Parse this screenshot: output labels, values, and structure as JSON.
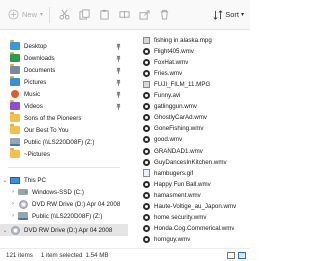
{
  "toolbar": {
    "new_label": "New",
    "sort_label": "Sort",
    "icons": [
      "cut-icon",
      "copy-icon",
      "paste-icon",
      "rename-icon",
      "share-icon",
      "delete-icon"
    ]
  },
  "nav": {
    "items": [
      {
        "label": "Desktop",
        "icon": "folder",
        "pinned": true
      },
      {
        "label": "Downloads",
        "icon": "folder",
        "pinned": true
      },
      {
        "label": "Documents",
        "icon": "folder",
        "pinned": true
      },
      {
        "label": "Pictures",
        "icon": "folder",
        "pinned": true
      },
      {
        "label": "Music",
        "icon": "folder",
        "pinned": true
      },
      {
        "label": "Videos",
        "icon": "folder",
        "pinned": true
      },
      {
        "label": "Sons of the Pioneers",
        "icon": "folder",
        "pinned": false
      },
      {
        "label": "Our Best To You",
        "icon": "folder",
        "pinned": false
      },
      {
        "label": "Public (\\\\LS220D08F) (Z:)",
        "icon": "netdrive",
        "pinned": false
      },
      {
        "label": "~Pictures",
        "icon": "folder",
        "pinned": false
      },
      {
        "label": "This PC",
        "icon": "pc",
        "pinned": false
      },
      {
        "label": "Windows-SSD (C:)",
        "icon": "drive",
        "pinned": false
      },
      {
        "label": "DVD RW Drive (D:) Apr 04 2008",
        "icon": "dvd",
        "pinned": false
      },
      {
        "label": "Public (\\\\LS220D08F) (Z:)",
        "icon": "netdrive",
        "pinned": false
      },
      {
        "label": "DVD RW Drive (D:) Apr 04 2008",
        "icon": "dvd",
        "pinned": false
      }
    ]
  },
  "files": [
    {
      "name": "fishing in alaska.mpg",
      "type": "mpg"
    },
    {
      "name": "Flight405.wmv",
      "type": "wmv"
    },
    {
      "name": "FoxHat.wmv",
      "type": "wmv"
    },
    {
      "name": "Fries.wmv",
      "type": "wmv"
    },
    {
      "name": "FUJI_FILM_11.MPG",
      "type": "mpg"
    },
    {
      "name": "Funny.avi",
      "type": "wmv"
    },
    {
      "name": "gatlinggun.wmv",
      "type": "wmv"
    },
    {
      "name": "GhostlyCarAd.wmv",
      "type": "wmv"
    },
    {
      "name": "GoneFishing.wmv",
      "type": "wmv"
    },
    {
      "name": "good.wmv",
      "type": "wmv"
    },
    {
      "name": "GRANDAD1.wmv",
      "type": "wmv"
    },
    {
      "name": "GuyDancesInKitchen.wmv",
      "type": "wmv"
    },
    {
      "name": "hambugers.gif",
      "type": "gif"
    },
    {
      "name": "Happy Fun Ball.wmv",
      "type": "wmv"
    },
    {
      "name": "hamasment.wmv",
      "type": "wmv"
    },
    {
      "name": "Haute-Voltige_au_Japon.wmv",
      "type": "wmv"
    },
    {
      "name": "home security.wmv",
      "type": "wmv"
    },
    {
      "name": "Honda.Cog.Commerical.wmv",
      "type": "wmv"
    },
    {
      "name": "hornguy.wmv",
      "type": "wmv"
    }
  ],
  "status": {
    "item_count": "121 items",
    "selection": "1 item selected",
    "size": "1.54 MB"
  }
}
